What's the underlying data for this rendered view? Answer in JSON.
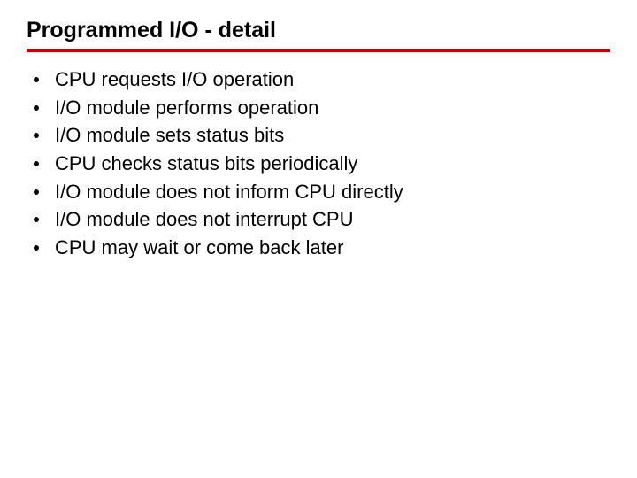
{
  "title": "Programmed I/O - detail",
  "bullets": [
    "CPU requests I/O operation",
    "I/O module performs operation",
    "I/O module sets status bits",
    "CPU checks status bits periodically",
    "I/O module does not inform CPU directly",
    "I/O module does not interrupt CPU",
    "CPU may wait or come back later"
  ]
}
